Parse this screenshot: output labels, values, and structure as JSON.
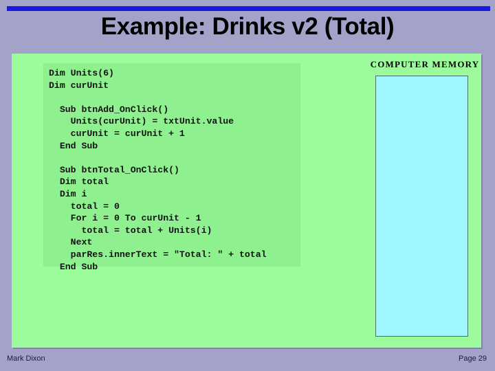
{
  "slide": {
    "title": "Example: Drinks v2 (Total)",
    "accent_color": "#1818e0",
    "background_color": "#a3a3ca",
    "panel_color": "#9cfc9c"
  },
  "code": {
    "language": "VBScript",
    "listing": "Dim Units(6)\nDim curUnit\n\n  Sub btnAdd_OnClick()\n    Units(curUnit) = txtUnit.value\n    curUnit = curUnit + 1\n  End Sub\n\n  Sub btnTotal_OnClick()\n  Dim total\n  Dim i\n    total = 0\n    For i = 0 To curUnit - 1\n      total = total + Units(i)\n    Next\n    parRes.innerText = \"Total: \" + total\n  End Sub",
    "box_color": "#8ef08e"
  },
  "memory": {
    "label": "COMPUTER MEMORY",
    "box_color": "#9ff6ff",
    "box_border_color": "#3f6f6f"
  },
  "footer": {
    "author": "Mark Dixon",
    "page": "Page 29"
  }
}
